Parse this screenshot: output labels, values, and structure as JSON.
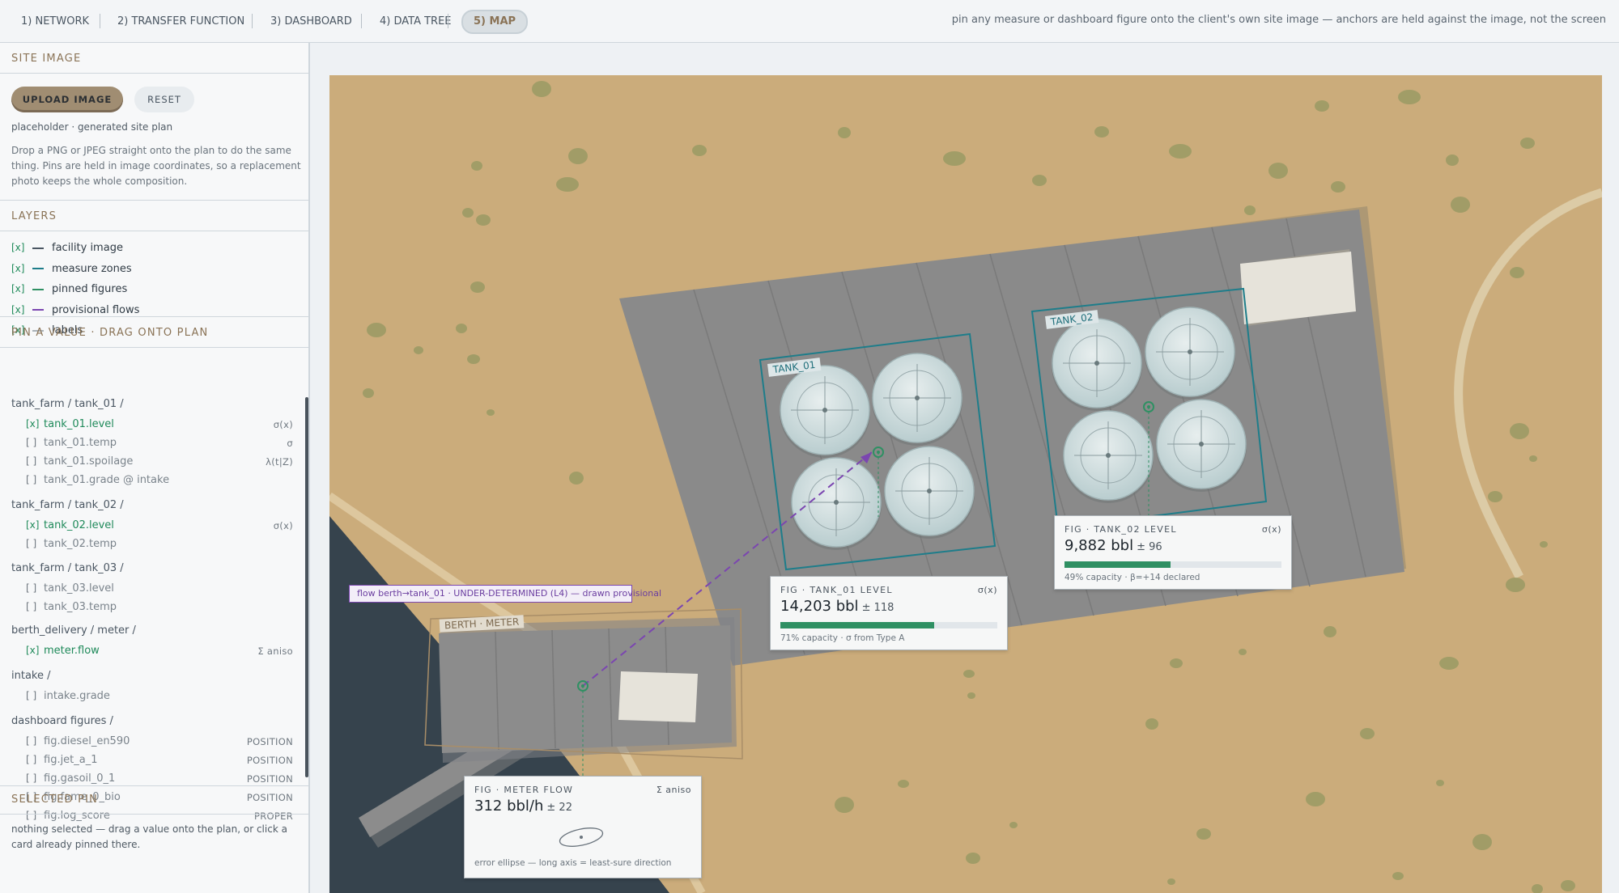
{
  "tabs": [
    {
      "label": "1) NETWORK"
    },
    {
      "label": "2) TRANSFER FUNCTION"
    },
    {
      "label": "3) DASHBOARD"
    },
    {
      "label": "4) DATA TREE"
    },
    {
      "label": "5) MAP"
    }
  ],
  "top_hint": "pin any measure or dashboard figure onto the client's own site image — anchors are held against the image, not the screen",
  "site_image": {
    "title": "SITE IMAGE",
    "upload_label": "UPLOAD IMAGE",
    "reset_label": "RESET",
    "source_note": "placeholder · generated site plan",
    "help": "Drop a PNG or JPEG straight onto the plan to do the same thing. Pins are held in image coordinates, so a replacement photo keeps the whole composition."
  },
  "layers": {
    "title": "LAYERS",
    "items": [
      {
        "check": "[x]",
        "label": "facility image",
        "color": "#4a5662"
      },
      {
        "check": "[x]",
        "label": "measure zones",
        "color": "#1e7d8a"
      },
      {
        "check": "[x]",
        "label": "pinned figures",
        "color": "#2f9063"
      },
      {
        "check": "[x]",
        "label": "provisional flows",
        "color": "#7b46b0"
      },
      {
        "check": "[x]",
        "label": "labels",
        "color": "#aab2b8"
      }
    ]
  },
  "pin_panel": {
    "title": "PIN A VALUE · DRAG ONTO PLAN",
    "groups": [
      {
        "name": "tank_farm / tank_01 /",
        "items": [
          {
            "check": "[x]",
            "label": "tank_01.level",
            "tag": "σ(x)",
            "on": true
          },
          {
            "check": "[ ]",
            "label": "tank_01.temp",
            "tag": "σ",
            "on": false
          },
          {
            "check": "[ ]",
            "label": "tank_01.spoilage",
            "tag": "λ(t|Z)",
            "on": false
          },
          {
            "check": "[ ]",
            "label": "tank_01.grade @ intake",
            "tag": "",
            "on": false
          }
        ]
      },
      {
        "name": "tank_farm / tank_02 /",
        "items": [
          {
            "check": "[x]",
            "label": "tank_02.level",
            "tag": "σ(x)",
            "on": true
          },
          {
            "check": "[ ]",
            "label": "tank_02.temp",
            "tag": "",
            "on": false
          }
        ]
      },
      {
        "name": "tank_farm / tank_03 /",
        "items": [
          {
            "check": "[ ]",
            "label": "tank_03.level",
            "tag": "",
            "on": false
          },
          {
            "check": "[ ]",
            "label": "tank_03.temp",
            "tag": "",
            "on": false
          }
        ]
      },
      {
        "name": "berth_delivery / meter /",
        "items": [
          {
            "check": "[x]",
            "label": "meter.flow",
            "tag": "Σ aniso",
            "on": true
          }
        ]
      },
      {
        "name": "intake /",
        "items": [
          {
            "check": "[ ]",
            "label": "intake.grade",
            "tag": "",
            "on": false
          }
        ]
      },
      {
        "name": "dashboard figures /",
        "items": [
          {
            "check": "[ ]",
            "label": "fig.diesel_en590",
            "tag": "POSITION",
            "on": false
          },
          {
            "check": "[ ]",
            "label": "fig.jet_a_1",
            "tag": "POSITION",
            "on": false
          },
          {
            "check": "[ ]",
            "label": "fig.gasoil_0_1",
            "tag": "POSITION",
            "on": false
          },
          {
            "check": "[ ]",
            "label": "fig.fame_0_bio",
            "tag": "POSITION",
            "on": false
          },
          {
            "check": "[ ]",
            "label": "fig.log_score",
            "tag": "PROPER",
            "on": false
          }
        ]
      }
    ]
  },
  "selected_pin": {
    "title": "SELECTED PIN",
    "empty_text": "nothing selected — drag a value onto the plan, or click a card already pinned there."
  },
  "map": {
    "zones": [
      "TANK_01",
      "TANK_02"
    ],
    "berth_label": "BERTH · METER",
    "flow_label": "flow berth→tank_01 · UNDER-DETERMINED (L4) — drawn provisional",
    "cards": {
      "tank01": {
        "head": "FIG · TANK_01 LEVEL",
        "head_right": "σ(x)",
        "value": "14,203 bbl",
        "unc": "± 118",
        "capacity_fraction": 0.71,
        "foot": "71% capacity · σ from Type A"
      },
      "tank02": {
        "head": "FIG · TANK_02 LEVEL",
        "head_right": "σ(x)",
        "value": "9,882 bbl",
        "unc": "± 96",
        "capacity_fraction": 0.49,
        "foot": "49% capacity · β=+14 declared"
      },
      "meter": {
        "head": "FIG · METER FLOW",
        "head_right": "Σ aniso",
        "value": "312 bbl/h",
        "unc": "± 22",
        "foot": "error ellipse — long axis = least-sure direction"
      }
    }
  }
}
